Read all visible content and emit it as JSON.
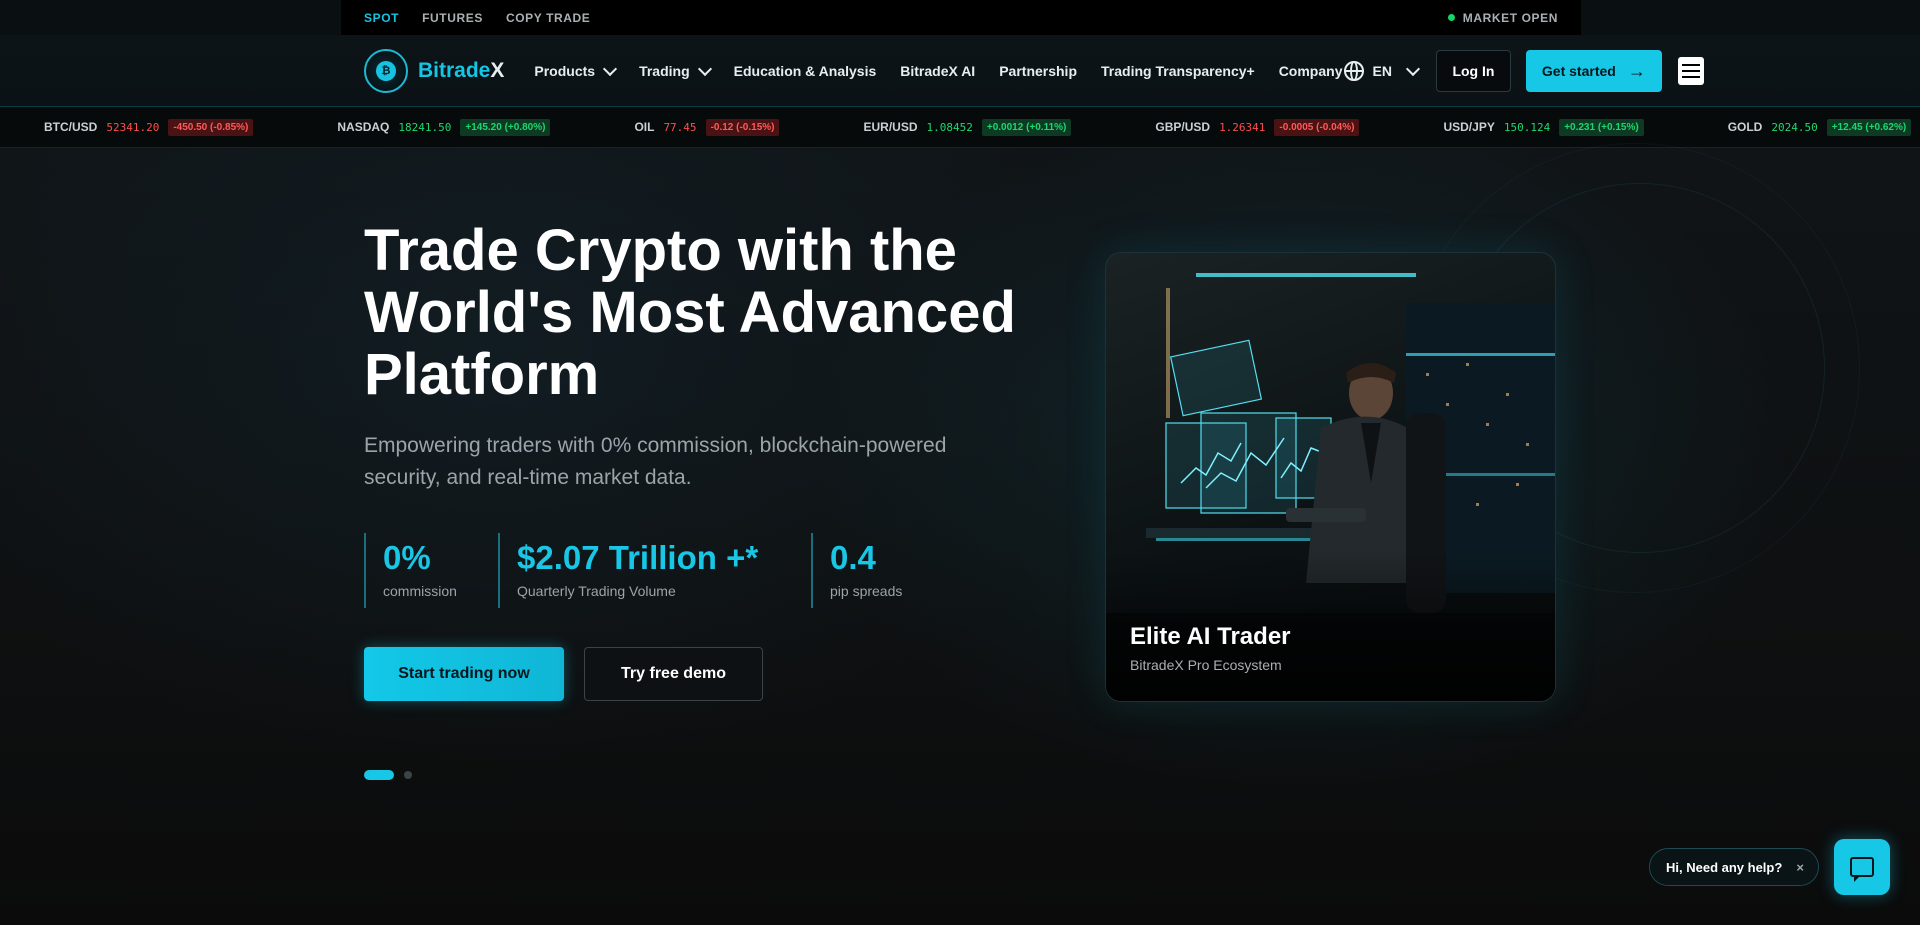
{
  "topbar": {
    "modes": [
      "SPOT",
      "FUTURES",
      "COPY TRADE"
    ],
    "active_mode": "SPOT",
    "status": "MARKET OPEN"
  },
  "nav": {
    "brand_a": "Bitrade",
    "brand_b": "X",
    "items": [
      {
        "label": "Products",
        "dropdown": true
      },
      {
        "label": "Trading",
        "dropdown": true
      },
      {
        "label": "Education & Analysis",
        "dropdown": false
      },
      {
        "label": "BitradeX AI",
        "dropdown": false
      },
      {
        "label": "Partnership",
        "dropdown": false
      },
      {
        "label": "Trading Transparency+",
        "dropdown": false
      },
      {
        "label": "Company",
        "dropdown": false
      }
    ],
    "language": "EN",
    "login": "Log In",
    "get_started": "Get started"
  },
  "ticker": [
    {
      "symbol": "BTC/USD",
      "price": "52341.20",
      "change": "-450.50 (-0.85%)",
      "direction": "down"
    },
    {
      "symbol": "NASDAQ",
      "price": "18241.50",
      "change": "+145.20 (+0.80%)",
      "direction": "up"
    },
    {
      "symbol": "OIL",
      "price": "77.45",
      "change": "-0.12 (-0.15%)",
      "direction": "down"
    },
    {
      "symbol": "EUR/USD",
      "price": "1.08452",
      "change": "+0.0012 (+0.11%)",
      "direction": "up"
    },
    {
      "symbol": "GBP/USD",
      "price": "1.26341",
      "change": "-0.0005 (-0.04%)",
      "direction": "down"
    },
    {
      "symbol": "USD/JPY",
      "price": "150.124",
      "change": "+0.231 (+0.15%)",
      "direction": "up"
    },
    {
      "symbol": "GOLD",
      "price": "2024.50",
      "change": "+12.45 (+0.62%)",
      "direction": "up"
    }
  ],
  "hero": {
    "headline": "Trade Crypto with the World's Most Advanced Platform",
    "subhead": "Empowering traders with 0% commission, blockchain-powered security, and real-time market data.",
    "stats": [
      {
        "value": "0%",
        "label": "commission"
      },
      {
        "value": "$2.07 Trillion +*",
        "label": "Quarterly Trading Volume"
      },
      {
        "value": "0.4",
        "label": "pip spreads"
      }
    ],
    "primary_cta": "Start trading now",
    "secondary_cta": "Try free demo",
    "slides_total": 2,
    "slide_active": 1
  },
  "card": {
    "title": "Elite AI Trader",
    "subtitle": "BitradeX Pro Ecosystem"
  },
  "chat": {
    "prompt": "Hi, Need any help?",
    "close": "×"
  },
  "colors": {
    "accent": "#17c7e6",
    "up": "#1ed66f",
    "down": "#ff4d4d"
  }
}
